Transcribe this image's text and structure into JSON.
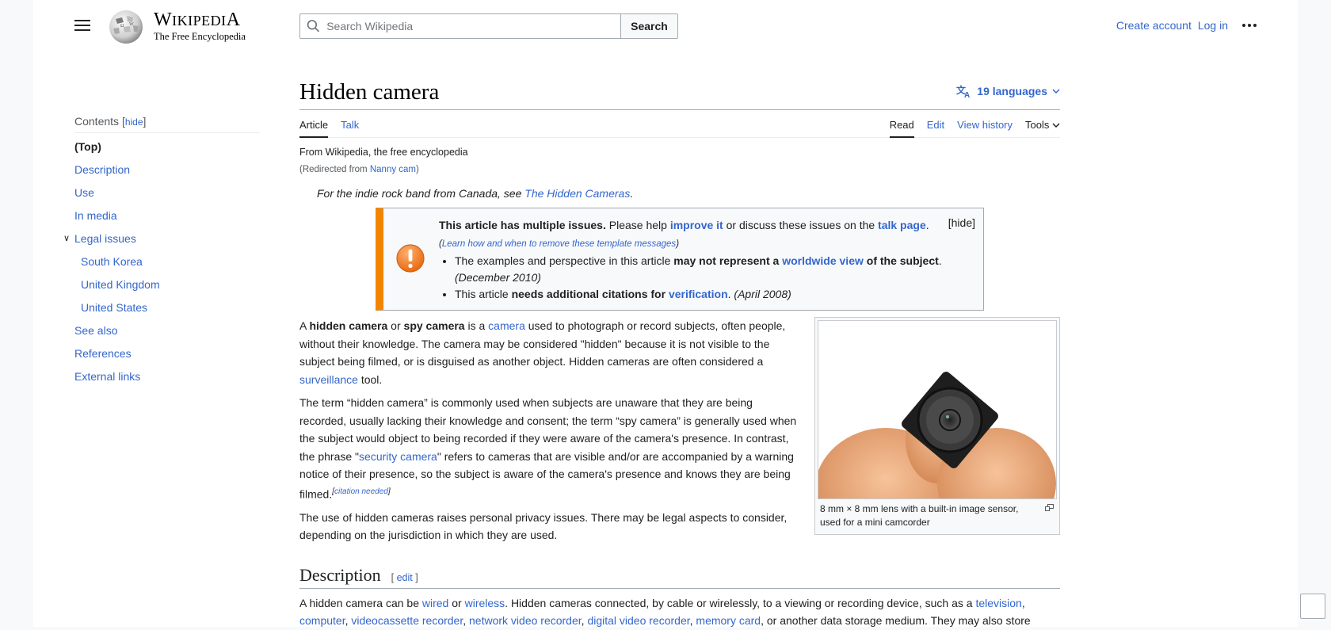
{
  "header": {
    "wordmark": "Wikipedia",
    "tagline": "The Free Encyclopedia",
    "search_placeholder": "Search Wikipedia",
    "search_button": "Search",
    "create_account": "Create account",
    "log_in": "Log in"
  },
  "toc": {
    "title": "Contents",
    "hide": "hide",
    "items": [
      {
        "label": "(Top)"
      },
      {
        "label": "Description"
      },
      {
        "label": "Use"
      },
      {
        "label": "In media"
      },
      {
        "label": "Legal issues"
      },
      {
        "label": "South Korea"
      },
      {
        "label": "United Kingdom"
      },
      {
        "label": "United States"
      },
      {
        "label": "See also"
      },
      {
        "label": "References"
      },
      {
        "label": "External links"
      }
    ]
  },
  "page": {
    "title": "Hidden camera",
    "languages": "19 languages",
    "tabs_left": [
      "Article",
      "Talk"
    ],
    "tabs_right": [
      "Read",
      "Edit",
      "View history",
      "Tools"
    ],
    "tagline": "From Wikipedia, the free encyclopedia",
    "redirect_prefix": "(Redirected from ",
    "redirect_link": "Nanny cam",
    "redirect_suffix": ")",
    "hatnote_prefix": "For the indie rock band from Canada, see ",
    "hatnote_link": "The Hidden Cameras",
    "hatnote_suffix": "."
  },
  "ambox": {
    "bold": "This article has multiple issues.",
    "t1": " Please help ",
    "improve": "improve it",
    "t2": " or discuss these issues on the ",
    "talk": "talk page",
    "t3": ". ",
    "learn": "Learn how and when to remove these template messages",
    "hide": "[hide]",
    "issue1_a": "The examples and perspective in this article ",
    "issue1_b": "may not represent a ",
    "issue1_link": "worldwide view",
    "issue1_c": " of the subject",
    "issue1_d": ". ",
    "issue1_date": "(December 2010)",
    "issue2_a": "This article ",
    "issue2_b": "needs additional citations for ",
    "issue2_link": "verification",
    "issue2_c": ". ",
    "issue2_date": "(April 2008)"
  },
  "article": {
    "p1": {
      "a": "A ",
      "b1": "hidden camera",
      "c": " or ",
      "b2": "spy camera",
      "d": " is a ",
      "link1": "camera",
      "e": " used to photograph or record subjects, often people, without their knowledge. The camera may be considered \"hidden\" because it is not visible to the subject being filmed, or is disguised as another object. Hidden cameras are often considered a ",
      "link2": "surveillance",
      "f": " tool."
    },
    "p2": {
      "a": "The term “hidden camera” is commonly used when subjects are unaware that they are being recorded, usually lacking their knowledge and consent; the term “spy camera” is generally used when the subject would object to being recorded if they were aware of the camera's presence. In contrast, the phrase \"",
      "link": "security camera",
      "b": "\" refers to cameras that are visible and/or are accompanied by a warning notice of their presence, so the subject is aware of the camera's presence and knows they are being filmed.",
      "cite_open": "[",
      "cite": "citation needed",
      "cite_close": "]"
    },
    "p3": "The use of hidden cameras raises personal privacy issues. There may be legal aspects to consider, depending on the jurisdiction in which they are used.",
    "thumb_caption": "8 mm × 8 mm lens with a built-in image sensor, used for a mini camcorder",
    "section_description": "Description",
    "edit_label": "edit",
    "desc": {
      "a": "A hidden camera can be ",
      "l1": "wired",
      "b": " or ",
      "l2": "wireless",
      "c": ". Hidden cameras connected, by cable or wirelessly, to a viewing or recording device, such as a ",
      "l3": "television",
      "d": ", ",
      "l4": "computer",
      "e": ", ",
      "l5": "videocassette recorder",
      "f": ", ",
      "l6": "network video recorder",
      "g": ", ",
      "l7": "digital video recorder",
      "h": ", ",
      "l8": "memory card",
      "i": ", or another data storage medium. They may also store"
    }
  },
  "colors": {
    "link": "#3366cc",
    "ambox_accent": "#f28500",
    "text": "#202122"
  }
}
